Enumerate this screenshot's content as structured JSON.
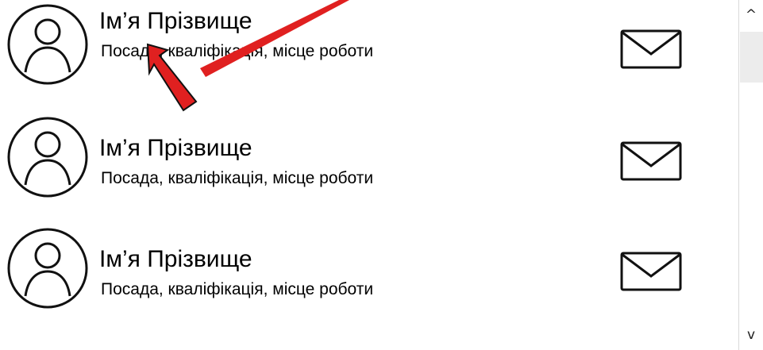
{
  "contacts": [
    {
      "name": "Ім’я Прізвище",
      "subtitle": "Посада, кваліфікація, місце роботи",
      "avatar_icon": "user-circle-icon",
      "action_icon": "envelope-icon"
    },
    {
      "name": "Ім’я Прізвище",
      "subtitle": "Посада, кваліфікація, місце роботи",
      "avatar_icon": "user-circle-icon",
      "action_icon": "envelope-icon"
    },
    {
      "name": "Ім’я Прізвище",
      "subtitle": "Посада, кваліфікація, місце роботи",
      "avatar_icon": "user-circle-icon",
      "action_icon": "envelope-icon"
    }
  ],
  "scrollbar": {
    "up_glyph": "^",
    "down_glyph": "v"
  },
  "annotation": {
    "arrow_color": "#e02020"
  }
}
